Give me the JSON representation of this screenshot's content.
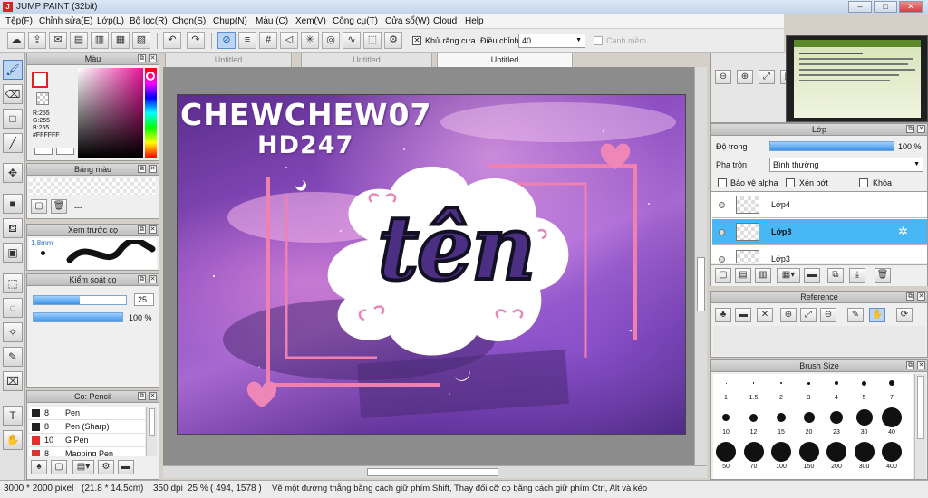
{
  "window": {
    "title": "JUMP PAINT (32bit)",
    "btn_min": "–",
    "btn_max": "□",
    "btn_close": "✕"
  },
  "menu": [
    "Tệp(F)",
    "Chỉnh sửa(E)",
    "Lớp(L)",
    "Bộ lọc(R)",
    "Chọn(S)",
    "Chụp(N)",
    "Màu (C)",
    "Xem(V)",
    "Công cụ(T)",
    "Cửa sổ(W)",
    "Cloud",
    "Help"
  ],
  "toolbar": {
    "antialias_label": "Khử răng cưa",
    "adjust_label": "Điều chỉnh",
    "adjust_value": "40",
    "canh_mem_label": "Canh mềm"
  },
  "tabs": [
    "Untitled",
    "Untitled",
    "Untitled"
  ],
  "color_panel": {
    "title": "Màu",
    "r": "R:255",
    "g": "G:255",
    "b": "B:255",
    "hex": "#FFFFFF"
  },
  "palette_panel": {
    "title": "Bảng màu",
    "dash": "---"
  },
  "preview_panel": {
    "title": "Xem trước cọ",
    "size": "1.8mm"
  },
  "brush_control": {
    "title": "Kiểm soát cọ",
    "size_value": "25",
    "opacity_value": "100 %",
    "size_fill": 0.5,
    "opacity_fill": 1.0
  },
  "brush_list": {
    "title": "Cọ: Pencil",
    "items": [
      {
        "size": "8",
        "name": "Pen",
        "color": "#222222"
      },
      {
        "size": "8",
        "name": "Pen (Sharp)",
        "color": "#222222"
      },
      {
        "size": "10",
        "name": "G Pen",
        "color": "#e03030"
      },
      {
        "size": "8",
        "name": "Mapping Pen",
        "color": "#e03030"
      }
    ]
  },
  "artwork": {
    "line1": "CHEWCHEW07",
    "line2": "HD247",
    "main_word": "tên"
  },
  "layer_panel": {
    "title": "Lớp",
    "opacity_label": "Độ trong",
    "opacity_value": "100 %",
    "blend_label": "Pha trộn",
    "blend_value": "Bình thường",
    "protect_alpha": "Bảo vệ alpha",
    "clipping": "Xén bớt",
    "lock": "Khóa",
    "layers": [
      {
        "name": "Lớp4",
        "selected": false
      },
      {
        "name": "Lớp3",
        "selected": true
      },
      {
        "name": "Lớp3",
        "selected": false
      }
    ]
  },
  "reference_panel": {
    "title": "Reference"
  },
  "brush_size_panel": {
    "title": "Brush Size",
    "row1": [
      "1",
      "1.5",
      "2",
      "3",
      "4",
      "5",
      "7"
    ],
    "row2": [
      "10",
      "12",
      "15",
      "20",
      "23",
      "30",
      "40"
    ],
    "row3": [
      "50",
      "70",
      "100",
      "150",
      "200",
      "300",
      "400"
    ]
  },
  "status": {
    "size": "3000 * 2000 pixel",
    "mm": "(21.8 * 14.5cm)",
    "dpi": "350 dpi",
    "zoom": "25 %",
    "coords": "( 494, 1578 )",
    "hint": "Vẽ một đường thẳng bằng cách giữ phím Shift, Thay đổi cỡ cọ bằng cách giữ phím Ctrl, Alt và kéo"
  }
}
